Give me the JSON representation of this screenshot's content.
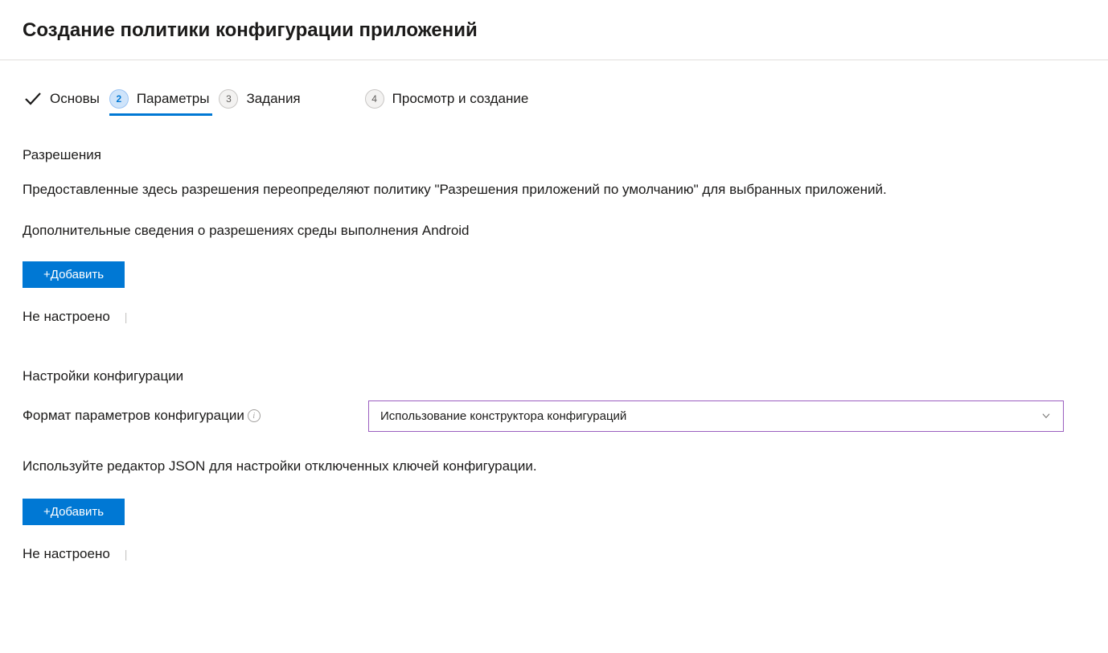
{
  "page": {
    "title": "Создание политики конфигурации приложений"
  },
  "stepper": {
    "steps": [
      {
        "label": "Основы"
      },
      {
        "number": "2",
        "label": "Параметры"
      },
      {
        "number": "3",
        "label": "Задания"
      },
      {
        "number": "4",
        "label": "Просмотр и создание"
      }
    ]
  },
  "permissions": {
    "title": "Разрешения",
    "description": "Предоставленные здесь разрешения переопределяют политику \"Разрешения приложений по умолчанию\" для выбранных приложений.",
    "link_text": "Дополнительные сведения о разрешениях среды выполнения Android",
    "add_button": "+Добавить",
    "status": "Не настроено"
  },
  "config": {
    "title": "Настройки конфигурации",
    "format_label": "Формат параметров конфигурации",
    "format_value": "Использование конструктора конфигураций",
    "json_hint": "Используйте редактор JSON для настройки отключенных ключей конфигурации.",
    "add_button": "+Добавить",
    "status": "Не настроено"
  }
}
